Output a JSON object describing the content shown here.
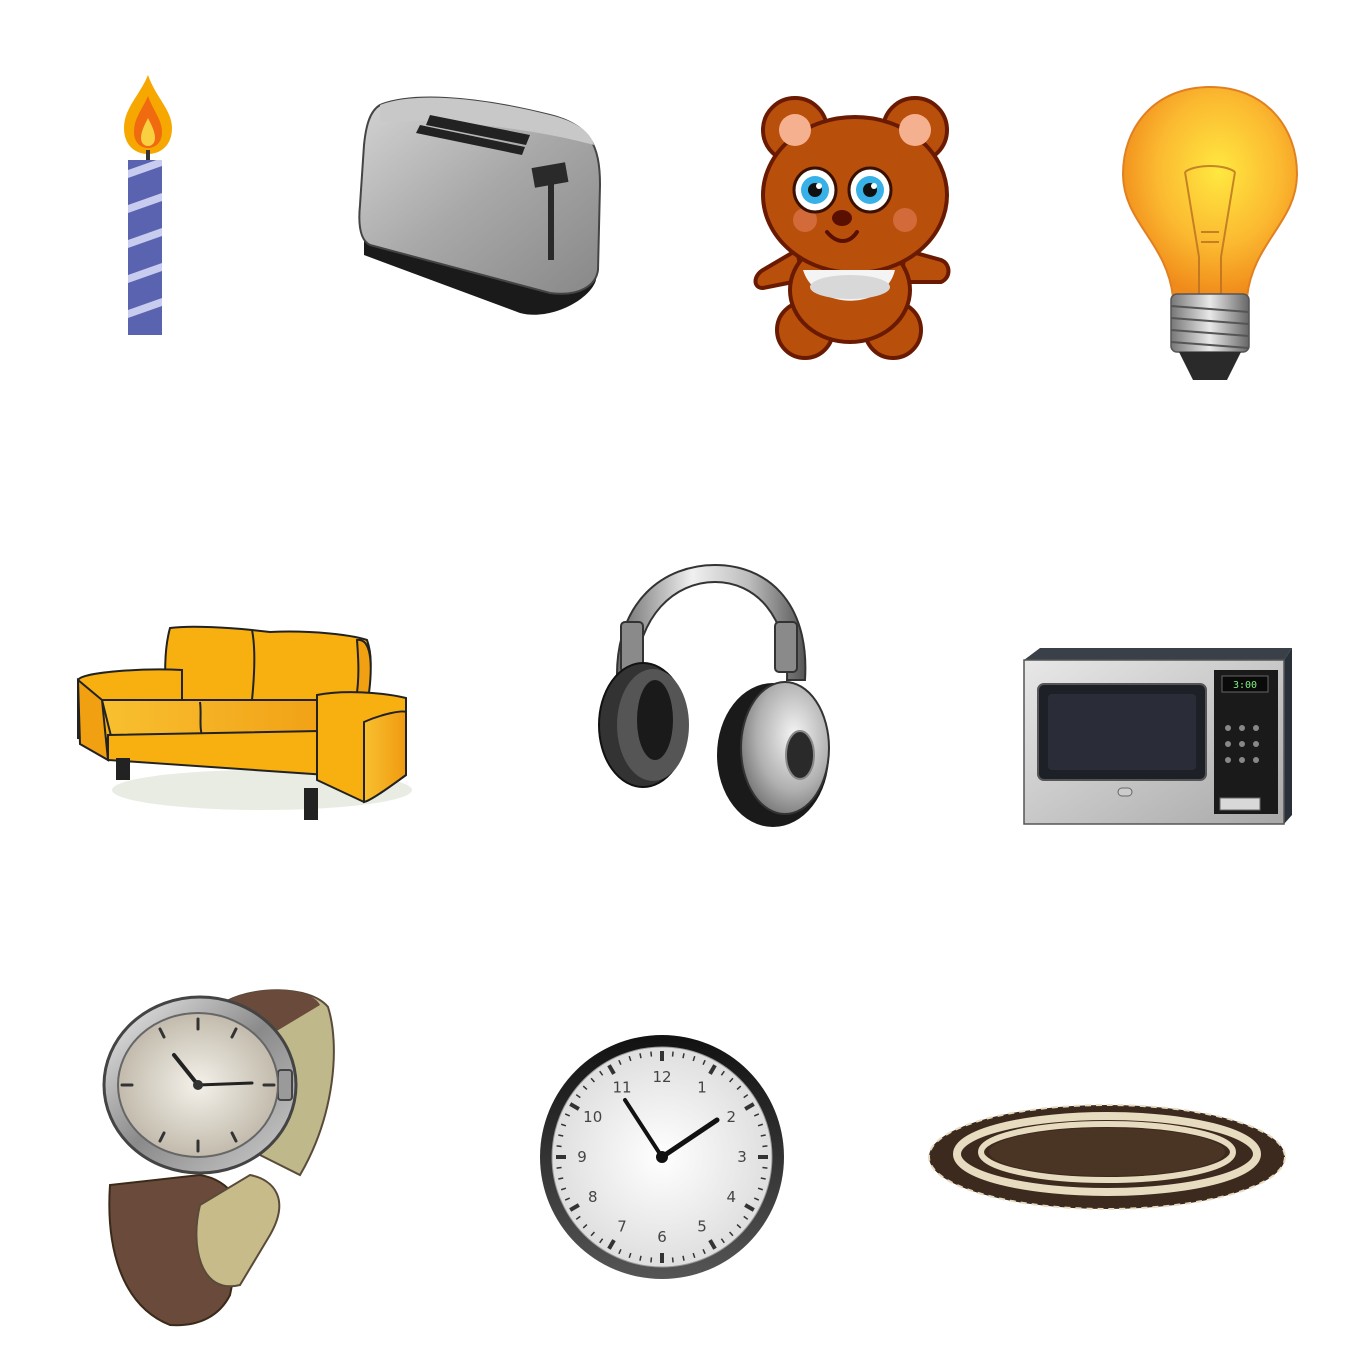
{
  "items": [
    {
      "name": "candle",
      "icon": "candle-icon"
    },
    {
      "name": "toaster",
      "icon": "toaster-icon"
    },
    {
      "name": "teddy-bear",
      "icon": "teddy-bear-icon"
    },
    {
      "name": "light-bulb",
      "icon": "light-bulb-icon"
    },
    {
      "name": "sofa",
      "icon": "sofa-icon"
    },
    {
      "name": "headphones",
      "icon": "headphones-icon"
    },
    {
      "name": "microwave",
      "icon": "microwave-icon"
    },
    {
      "name": "wristwatch",
      "icon": "wristwatch-icon"
    },
    {
      "name": "wall-clock",
      "icon": "wall-clock-icon"
    },
    {
      "name": "rug",
      "icon": "rug-icon"
    }
  ],
  "microwave": {
    "display": "3:00"
  },
  "wall_clock": {
    "numbers": [
      "12",
      "1",
      "2",
      "3",
      "4",
      "5",
      "6",
      "7",
      "8",
      "9",
      "10",
      "11"
    ]
  },
  "colors": {
    "candle_blue": "#5a63b0",
    "sofa_orange": "#f6b012",
    "bear_brown": "#b8500c",
    "bulb_orange": "#f8a928",
    "rug_brown": "#3d2a1e",
    "rug_cream": "#e8dcc0"
  }
}
